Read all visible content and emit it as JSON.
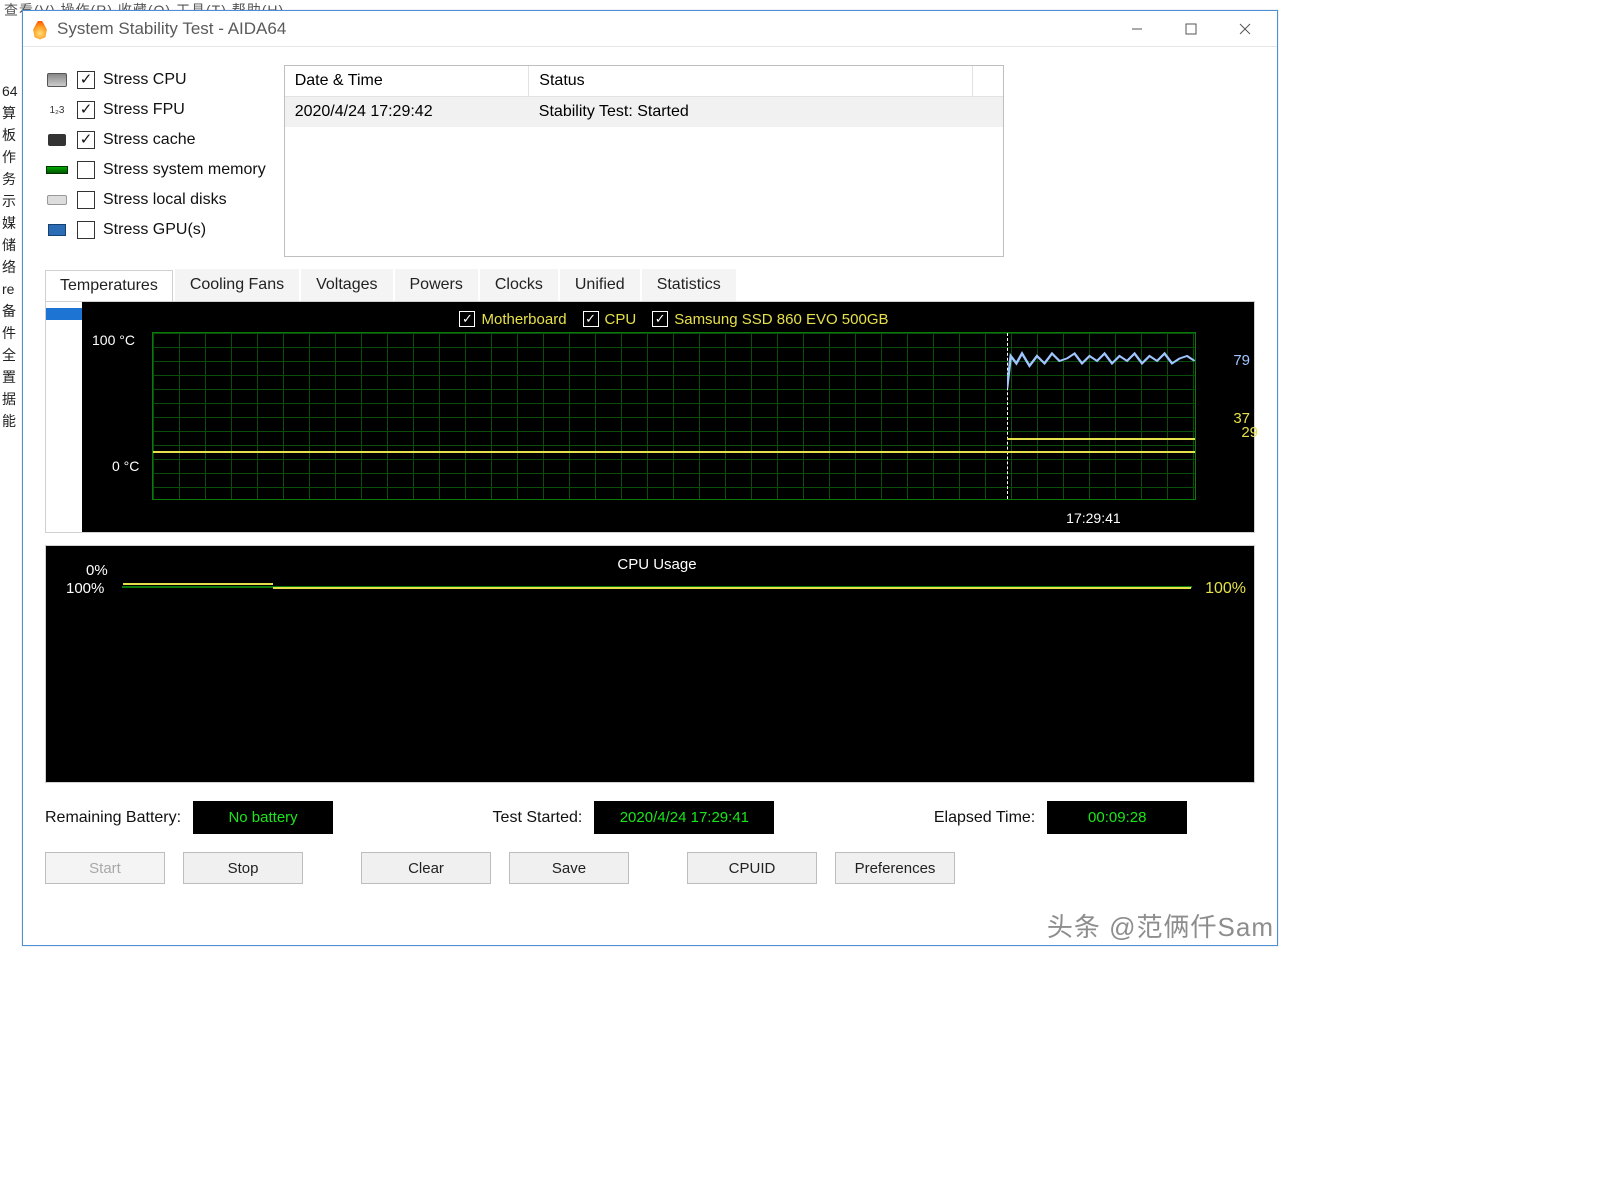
{
  "bg_menubar": "查看(V)  操作(R)  收藏(O)  工具(T)  帮助(H)",
  "bg_sidebar_items": [
    "64",
    "算",
    "板",
    "作",
    "务",
    "示",
    "媒",
    "储",
    "络",
    "re",
    "备",
    "件",
    "全",
    "置",
    "据",
    "能"
  ],
  "window": {
    "title": "System Stability Test - AIDA64"
  },
  "stress": {
    "items": [
      {
        "label": "Stress CPU",
        "checked": true,
        "icon": "cpu"
      },
      {
        "label": "Stress FPU",
        "checked": true,
        "icon": "fpu"
      },
      {
        "label": "Stress cache",
        "checked": true,
        "icon": "cache"
      },
      {
        "label": "Stress system memory",
        "checked": false,
        "icon": "ram"
      },
      {
        "label": "Stress local disks",
        "checked": false,
        "icon": "disk"
      },
      {
        "label": "Stress GPU(s)",
        "checked": false,
        "icon": "gpu"
      }
    ]
  },
  "log": {
    "headers": [
      "Date & Time",
      "Status"
    ],
    "rows": [
      {
        "datetime": "2020/4/24 17:29:42",
        "status": "Stability Test: Started"
      }
    ]
  },
  "tabs": [
    "Temperatures",
    "Cooling Fans",
    "Voltages",
    "Powers",
    "Clocks",
    "Unified",
    "Statistics"
  ],
  "active_tab": 0,
  "chart_data": [
    {
      "type": "line",
      "title": "",
      "ylabel": "°C",
      "ylim": [
        0,
        100
      ],
      "x_marker_label": "17:29:41",
      "series": [
        {
          "name": "Motherboard",
          "color": "#e6e04a",
          "checked": true,
          "current": 37,
          "values": [
            29,
            29,
            29,
            29,
            29,
            29,
            29,
            29,
            29,
            29,
            29,
            29,
            29,
            29,
            37,
            37,
            37,
            37,
            37,
            37
          ]
        },
        {
          "name": "CPU",
          "color": "#9fc5ff",
          "checked": true,
          "current": 79,
          "values": [
            29,
            29,
            29,
            29,
            29,
            29,
            29,
            29,
            29,
            29,
            29,
            29,
            29,
            29,
            74,
            80,
            77,
            81,
            78,
            79
          ]
        },
        {
          "name": "Samsung SSD 860 EVO 500GB",
          "color": "#e6e04a",
          "checked": true,
          "current": 29,
          "values": [
            29,
            29,
            29,
            29,
            29,
            29,
            29,
            29,
            29,
            29,
            29,
            29,
            29,
            29,
            29,
            29,
            29,
            29,
            29,
            29
          ]
        }
      ],
      "yticks": [
        "100 °C",
        "0 °C"
      ]
    },
    {
      "type": "line",
      "title": "CPU Usage",
      "ylabel": "%",
      "ylim": [
        0,
        100
      ],
      "series": [
        {
          "name": "CPU Usage",
          "color": "#e6e04a",
          "current": "100%",
          "values": [
            1,
            1,
            2,
            1,
            3,
            2,
            1,
            4,
            100,
            100,
            100,
            100,
            100,
            100,
            100,
            100,
            100,
            100,
            100,
            100,
            100,
            100,
            100,
            100,
            100,
            100,
            100,
            100,
            100,
            100,
            100,
            100,
            100,
            100,
            100,
            100,
            100,
            100,
            100,
            100,
            100,
            100,
            100,
            100,
            100,
            100,
            100,
            100,
            100,
            100
          ]
        }
      ],
      "yticks": [
        "100%",
        "0%"
      ]
    }
  ],
  "status": {
    "battery_label": "Remaining Battery:",
    "battery_value": "No battery",
    "started_label": "Test Started:",
    "started_value": "2020/4/24 17:29:41",
    "elapsed_label": "Elapsed Time:",
    "elapsed_value": "00:09:28"
  },
  "buttons": {
    "start": "Start",
    "stop": "Stop",
    "clear": "Clear",
    "save": "Save",
    "cpuid": "CPUID",
    "prefs": "Preferences"
  },
  "watermark": "头条 @范俩仟Sam"
}
